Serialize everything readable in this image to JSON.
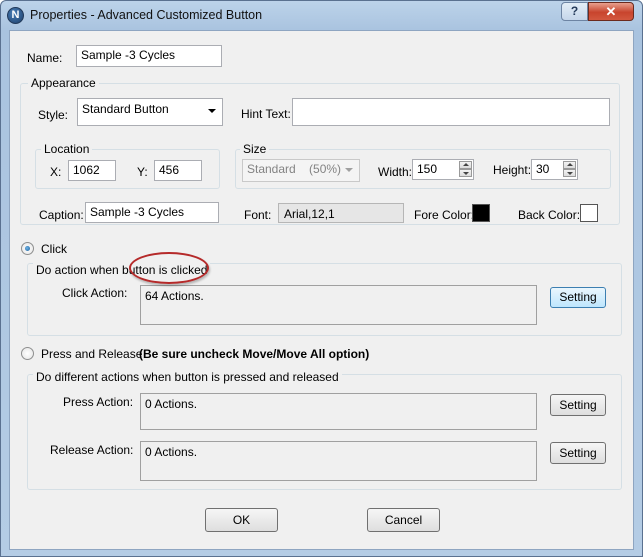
{
  "window": {
    "title": "Properties - Advanced Customized Button",
    "app_icon_letter": "N",
    "help_glyph": "?",
    "close_glyph": "✕"
  },
  "name": {
    "label": "Name:",
    "value": "Sample -3 Cycles"
  },
  "appearance": {
    "title": "Appearance",
    "style_label": "Style:",
    "style_value": "Standard Button",
    "hint_label": "Hint Text:",
    "hint_value": ""
  },
  "location": {
    "title": "Location",
    "x_label": "X:",
    "x_value": "1062",
    "y_label": "Y:",
    "y_value": "456"
  },
  "size": {
    "title": "Size",
    "preset_value": "Standard    (50%)",
    "width_label": "Width:",
    "width_value": "150",
    "height_label": "Height:",
    "height_value": "30"
  },
  "caption": {
    "label": "Caption:",
    "value": "Sample -3 Cycles"
  },
  "font": {
    "label": "Font:",
    "value": "Arial,12,1"
  },
  "fore_color": {
    "label": "Fore Color:",
    "color": "#000000"
  },
  "back_color": {
    "label": "Back Color:",
    "color": "#ffffff"
  },
  "click_mode": {
    "radio_label": "Click",
    "checked": true,
    "group_title": "Do action when button is clicked",
    "action_label": "Click Action:",
    "action_value": "64 Actions.",
    "setting_label": "Setting"
  },
  "press_release_mode": {
    "radio_label": "Press and Release",
    "note": "(Be sure uncheck Move/Move All option)",
    "checked": false,
    "group_title": "Do different actions when button is pressed and released",
    "press_label": "Press Action:",
    "press_value": "0 Actions.",
    "press_setting_label": "Setting",
    "release_label": "Release Action:",
    "release_value": "0 Actions.",
    "release_setting_label": "Setting"
  },
  "footer": {
    "ok_label": "OK",
    "cancel_label": "Cancel"
  },
  "colors": {
    "annotation": "#b52a2a",
    "titlebar": "#a9c3df"
  }
}
